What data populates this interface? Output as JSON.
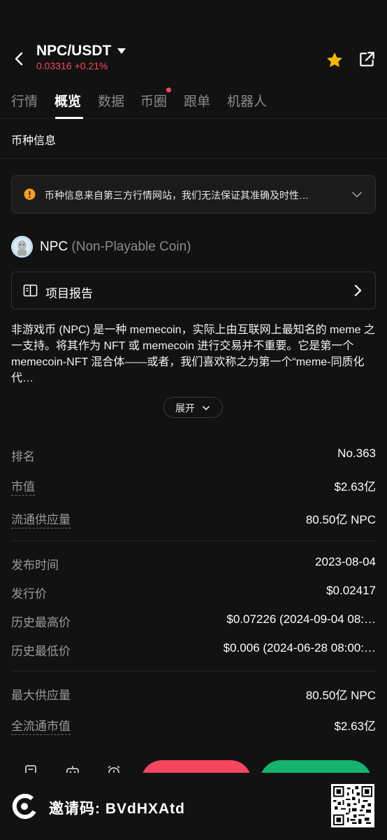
{
  "header": {
    "pair": "NPC/USDT",
    "last_price": "0.03316",
    "change": "+0.21%",
    "icons": {
      "back": "chevron-left-icon",
      "dropdown": "caret-down-icon",
      "favorite": "star-icon",
      "share": "share-icon"
    },
    "favorite_color": "#f5b800",
    "down_color": "#f6465d"
  },
  "tabs": [
    {
      "label": "行情"
    },
    {
      "label": "概览",
      "active": true
    },
    {
      "label": "数据"
    },
    {
      "label": "币圈",
      "badge": true
    },
    {
      "label": "跟单"
    },
    {
      "label": "机器人"
    }
  ],
  "section_title": "币种信息",
  "notice": {
    "text": "币种信息来自第三方行情网站，我们无法保证其准确及时性…",
    "icon": "warning-icon",
    "accent": "#f0a020"
  },
  "coin": {
    "symbol": "NPC",
    "full_name": "(Non-Playable Coin)"
  },
  "report": {
    "label": "项目报告"
  },
  "description": "非游戏币 (NPC) 是一种 memecoin，实际上由互联网上最知名的 meme 之一支持。将其作为 NFT 或 memecoin 进行交易并不重要。它是第一个 memecoin-NFT 混合体——或者，我们喜欢称之为第一个“meme-同质化代…",
  "expand_label": "展开",
  "stats": {
    "rank": {
      "label": "排名",
      "value": "No.363"
    },
    "market_cap": {
      "label": "市值",
      "value": "$2.63亿"
    },
    "circulating": {
      "label": "流通供应量",
      "value": "80.50亿 NPC"
    },
    "launch_date": {
      "label": "发布时间",
      "value": "2023-08-04"
    },
    "issue_price": {
      "label": "发行价",
      "value": "$0.02417"
    },
    "ath": {
      "label": "历史最高价",
      "value": "$0.07226 (2024-09-04 08:…"
    },
    "atl": {
      "label": "历史最低价",
      "value": "$0.006 (2024-06-28 08:00:…"
    },
    "max_supply": {
      "label": "最大供应量",
      "value": "80.50亿 NPC"
    },
    "fdv": {
      "label": "全流通市值",
      "value": "$2.63亿"
    }
  },
  "footer": {
    "invite": "邀请码: BVdHXAtd"
  }
}
